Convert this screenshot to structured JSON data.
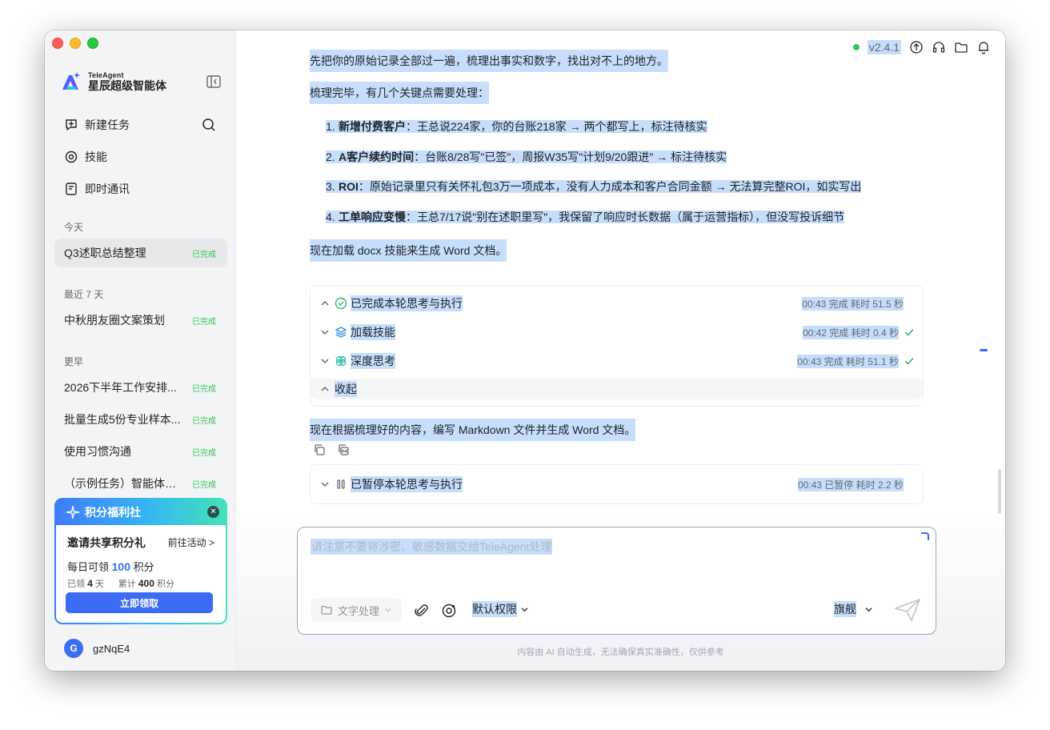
{
  "brand": {
    "en": "TeleAgent",
    "cn": "星辰超级智能体"
  },
  "nav": {
    "new_task": "新建任务",
    "skills": "技能",
    "im": "即时通讯"
  },
  "sections": {
    "today": "今天",
    "last7": "最近 7 天",
    "earlier": "更早"
  },
  "tasks": {
    "today": [
      {
        "title": "Q3述职总结整理",
        "status": "已完成"
      }
    ],
    "last7": [
      {
        "title": "中秋朋友圈文案策划",
        "status": "已完成"
      }
    ],
    "earlier": [
      {
        "title": "2026下半年工作安排...",
        "status": "已完成"
      },
      {
        "title": "批量生成5份专业样本...",
        "status": "已完成"
      },
      {
        "title": "使用习惯沟通",
        "status": "已完成"
      },
      {
        "title": "（示例任务）智能体招...",
        "status": "已完成"
      }
    ]
  },
  "promo": {
    "header": "积分福利社",
    "title": "邀请共享积分礼",
    "link": "前往活动 >",
    "daily_prefix": "每日可领",
    "daily_amount": "100",
    "daily_suffix": "积分",
    "claimed_label": "已领",
    "claimed_days": "4",
    "claimed_unit": "天",
    "total_label": "累计",
    "total_points": "400",
    "total_unit": "积分",
    "button": "立即领取",
    "close": "×"
  },
  "user": {
    "initial": "G",
    "name": "gzNqE4"
  },
  "topbar": {
    "version": "v2.4.1"
  },
  "content": {
    "line0": "先把你的原始记录全部过一遍，梳理出事实和数字，找出对不上的地方。",
    "line1": "梳理完毕，有几个关键点需要处理：",
    "items": [
      {
        "num": "1.",
        "bold": "新增付费客户",
        "text": "：王总说224家，你的台账218家 → 两个都写上，标注待核实"
      },
      {
        "num": "2.",
        "bold": "A客户续约时间",
        "text": "：台账8/28写\"已签\"，周报W35写\"计划9/20跟进\" → 标注待核实"
      },
      {
        "num": "3.",
        "bold": "ROI",
        "text": "：原始记录里只有关怀礼包3万一项成本，没有人力成本和客户合同金额 → 无法算完整ROI，如实写出"
      },
      {
        "num": "4.",
        "bold": "工单响应变慢",
        "text": "：王总7/17说\"别在述职里写\"，我保留了响应时长数据（属于运营指标），但没写投诉细节"
      }
    ],
    "line_docx": "现在加载 docx 技能来生成 Word 文档。",
    "line_md": "现在根据梳理好的内容，编写 Markdown 文件并生成 Word 文档。"
  },
  "steps": [
    {
      "label": "已完成本轮思考与执行",
      "time": "00:43 完成 耗时 51.5 秒"
    },
    {
      "label": "加载技能",
      "time": "00:42 完成 耗时 0.4 秒"
    },
    {
      "label": "深度思考",
      "time": "00:43 完成 耗时 51.1 秒"
    },
    {
      "label": "收起",
      "time": ""
    }
  ],
  "paused_step": {
    "label": "已暂停本轮思考与执行",
    "time": "00:43 已暂停 耗时 2.2 秒"
  },
  "composer": {
    "placeholder": "请注意不要将涉密、敏感数据交给TeleAgent处理",
    "chip": "文字处理",
    "permission": "默认权限",
    "model": "旗舰"
  },
  "footer": "内容由 AI 自动生成，无法确保真实准确性，仅供参考"
}
